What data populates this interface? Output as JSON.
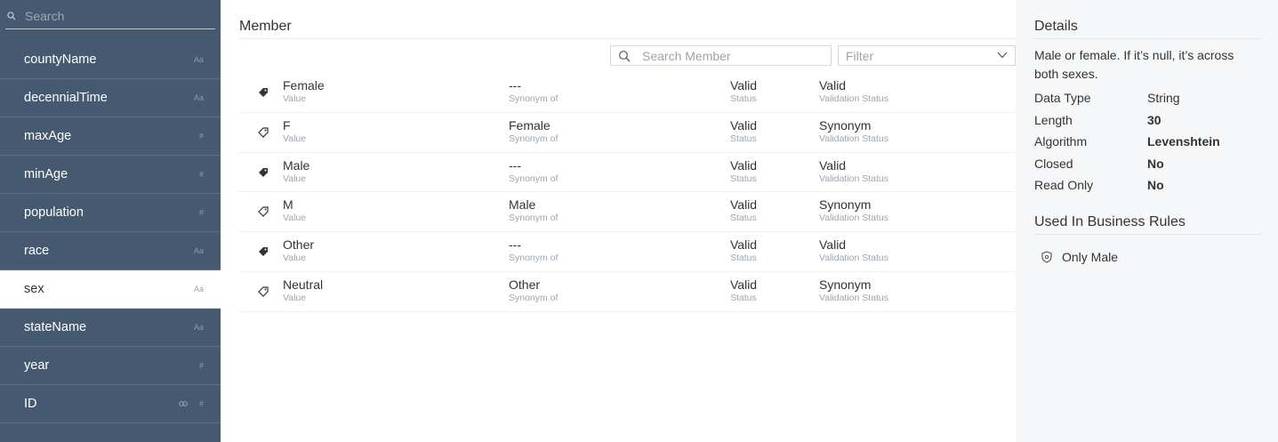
{
  "sidebar": {
    "search_placeholder": "Search",
    "items": [
      {
        "label": "countyName",
        "type": "Aa"
      },
      {
        "label": "decennialTime",
        "type": "Aa"
      },
      {
        "label": "maxAge",
        "type": "#"
      },
      {
        "label": "minAge",
        "type": "#"
      },
      {
        "label": "population",
        "type": "#"
      },
      {
        "label": "race",
        "type": "Aa"
      },
      {
        "label": "sex",
        "type": "Aa"
      },
      {
        "label": "stateName",
        "type": "Aa"
      },
      {
        "label": "year",
        "type": "#"
      },
      {
        "label": "ID",
        "type": "#"
      }
    ]
  },
  "main": {
    "title": "Member",
    "search_placeholder": "Search Member",
    "filter_placeholder": "Filter",
    "sublabels": {
      "value": "Value",
      "synonym_of": "Synonym of",
      "status": "Status",
      "validation_status": "Validation Status"
    },
    "rows": [
      {
        "value": "Female",
        "synonym_of": "---",
        "status": "Valid",
        "validation": "Valid",
        "tag": "filled"
      },
      {
        "value": "F",
        "synonym_of": "Female",
        "status": "Valid",
        "validation": "Synonym",
        "tag": "outline"
      },
      {
        "value": "Male",
        "synonym_of": "---",
        "status": "Valid",
        "validation": "Valid",
        "tag": "filled"
      },
      {
        "value": "M",
        "synonym_of": "Male",
        "status": "Valid",
        "validation": "Synonym",
        "tag": "outline"
      },
      {
        "value": "Other",
        "synonym_of": "---",
        "status": "Valid",
        "validation": "Valid",
        "tag": "filled"
      },
      {
        "value": "Neutral",
        "synonym_of": "Other",
        "status": "Valid",
        "validation": "Synonym",
        "tag": "outline"
      }
    ]
  },
  "details": {
    "title": "Details",
    "description": "Male or female. If it’s null, it’s across both sexes.",
    "properties": [
      {
        "key": "Data Type",
        "value": "String",
        "bold": false
      },
      {
        "key": "Length",
        "value": "30",
        "bold": true
      },
      {
        "key": "Algorithm",
        "value": "Levenshtein",
        "bold": true
      },
      {
        "key": "Closed",
        "value": "No",
        "bold": true
      },
      {
        "key": "Read Only",
        "value": "No",
        "bold": true
      }
    ],
    "rules_title": "Used In Business Rules",
    "rules": [
      {
        "label": "Only Male"
      }
    ]
  },
  "colors": {
    "sidebar_bg": "#455a70",
    "details_bg": "#f6f7f9",
    "text": "#333333",
    "muted": "#9aa5b0"
  }
}
